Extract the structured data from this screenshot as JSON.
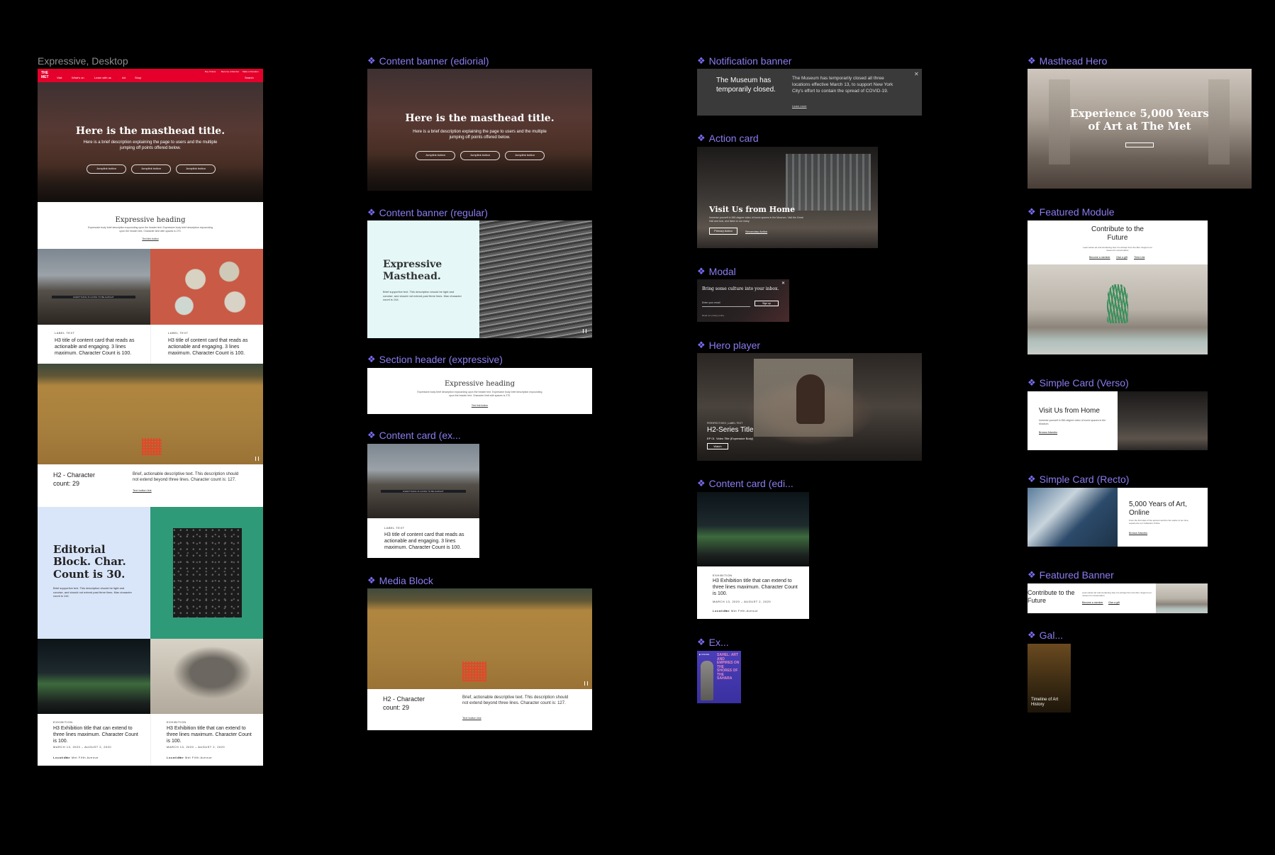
{
  "labels": {
    "expressive_desktop": "Expressive, Desktop",
    "content_banner_editorial": "Content banner (ediorial)",
    "content_banner_regular": "Content banner (regular)",
    "section_header_expressive": "Section header (expressive)",
    "content_card_ex": "Content card (ex...",
    "media_block": "Media Block",
    "notification_banner": "Notification banner",
    "action_card": "Action card",
    "modal": "Modal",
    "hero_player": "Hero player",
    "content_card_edi": "Content card (edi...",
    "ex": "Ex...",
    "masthead_hero": "Masthead Hero",
    "featured_module": "Featured Module",
    "simple_card_verso": "Simple Card (Verso)",
    "simple_card_recto": "Simple Card (Recto)",
    "featured_banner": "Featured Banner",
    "gal": "Gal..."
  },
  "nav": {
    "logo": "THE MET",
    "items": [
      "Visit",
      "What's on",
      "Learn with us",
      "Art",
      "Shop"
    ],
    "utility": [
      "Buy Tickets",
      "Become a Member",
      "Make a Donation"
    ],
    "search": "Search"
  },
  "masthead": {
    "title": "Here is the masthead title.",
    "description": "Here is a brief description explaining the page to users and the multiple jumping off points offered below.",
    "buttons": [
      "Jumplink button",
      "Jumplink button",
      "Jumplink button"
    ]
  },
  "expressive_heading": {
    "title": "Expressive heading",
    "body": "Expressive body brief description expounding upon the header text. Expressive body brief description expounding upon the header text. Character limit with spaces is 270.",
    "link": "Text link button"
  },
  "content_card": {
    "label": "LABEL TEXT",
    "title": "H3 title of content card that reads as actionable and engaging. 3 lines maximum. Character Count is 100.",
    "building_text": "EVERYTHING IS GOING TO BE ALRIGHT"
  },
  "media_block": {
    "title": "H2 - Character count: 29",
    "body": "Brief, actionable descriptive text. This description should not extend beyond three lines. Character count is: 127.",
    "link": "Text button link"
  },
  "editorial_block": {
    "title": "Editorial Block. Char. Count is 30.",
    "body": "Brief supportive text. This description should be light and concise, and should not extend past three lines. Max character count is 144."
  },
  "exhibition_card": {
    "label": "EXHIBITION",
    "title": "H3 Exhibition title that can extend to three lines maximum. Character Count is 100.",
    "dates": "MARCH 13, 2020 – AUGUST 2, 2020",
    "location_label": "Location:",
    "location": "The Met Fifth Avenue"
  },
  "regular_banner": {
    "title": "Expressive Masthead.",
    "body": "Brief supportive text. This description should be light and concise, and should not extend past three lines. Max character count is 144."
  },
  "notification": {
    "title": "The Museum has temporarily closed.",
    "body": "The Museum has temporarily closed all three locations effective March 13, to support New York City's effort to contain the spread of COVID-19.",
    "link": "Learn more"
  },
  "action_card": {
    "title": "Visit Us from Home",
    "body": "Immerse yourself in 360-degree video of iconic spaces in the Museum. Visit the Great Hall and look, and listen to our many.",
    "primary": "Primary Action",
    "secondary": "Secondary Action"
  },
  "modal": {
    "title": "Bring some culture into your inbox.",
    "input_placeholder": "Enter your email",
    "button": "Sign up",
    "footnote": "Read our privacy policy"
  },
  "hero_player": {
    "label": "PERSPECTIVES | LABEL TEXT",
    "title": "H2-Series Title",
    "episode": "EP 01",
    "subtitle": "Video Title (Expressive Body)",
    "button": "Watch"
  },
  "masthead_hero": {
    "title": "Experience 5,000 Years of Art at The Met"
  },
  "featured_module": {
    "title": "Contribute to the Future",
    "body": "Learn about art and wondering how it is all kept from the Met. Support our museum's conservation.",
    "links": [
      "Become a member",
      "Give a gift",
      "Third Link"
    ]
  },
  "simple_verso": {
    "title": "Visit Us from Home",
    "body": "Immerse yourself in 360-degree video of iconic spaces in the Museum.",
    "link": "Browse Artworks"
  },
  "simple_recto": {
    "title": "5,000 Years of Art, Online",
    "body": "From the first sites of the ancient world to the works of our time, experience our Collection Online.",
    "link": "Browse Artworks"
  },
  "featured_banner": {
    "title": "Contribute to the Future",
    "body": "Learn about art and wondering how it is all kept from the Met. Support our museum's conservation.",
    "links": [
      "Become a member",
      "Give a gift"
    ]
  },
  "ex_card": {
    "badge": "ONLINE",
    "title": "SAHEL: ART AND EMPIRES ON THE SHORES OF THE SAHARA"
  },
  "gallery_card": {
    "title": "Timeline of Art History"
  }
}
